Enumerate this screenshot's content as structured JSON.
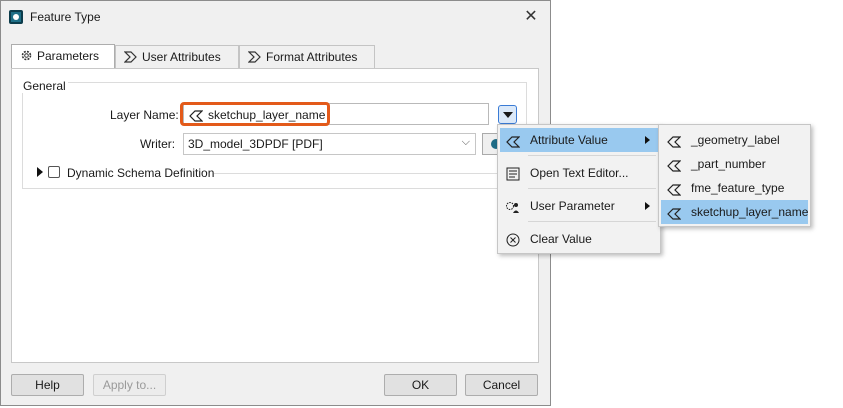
{
  "window": {
    "title": "Feature Type"
  },
  "tabs": [
    {
      "label": "Parameters",
      "icon": "gear-icon"
    },
    {
      "label": "User Attributes",
      "icon": "attribute-icon"
    },
    {
      "label": "Format Attributes",
      "icon": "attribute-icon"
    }
  ],
  "general": {
    "group_title": "General",
    "layer_name_label": "Layer Name:",
    "layer_name_value": "sketchup_layer_name",
    "writer_label": "Writer:",
    "writer_value": "3D_model_3DPDF [PDF]",
    "schema_label": "Dynamic Schema Definition",
    "schema_checked": false
  },
  "buttons": {
    "help": "Help",
    "apply": "Apply to...",
    "ok": "OK",
    "cancel": "Cancel"
  },
  "context_menu": {
    "items": [
      {
        "label": "Attribute Value",
        "icon": "attribute-icon",
        "submenu": true,
        "highlighted": true
      },
      {
        "label": "Open Text Editor...",
        "icon": "text-editor-icon",
        "submenu": false
      },
      {
        "label": "User Parameter",
        "icon": "user-parameter-icon",
        "submenu": true
      },
      {
        "label": "Clear Value",
        "icon": "clear-icon",
        "submenu": false
      }
    ]
  },
  "attribute_submenu": {
    "items": [
      {
        "label": "_geometry_label"
      },
      {
        "label": "_part_number"
      },
      {
        "label": "fme_feature_type"
      },
      {
        "label": "sketchup_layer_name",
        "highlighted": true
      }
    ]
  },
  "colors": {
    "highlight_outline": "#e35a1a",
    "menu_highlight": "#99c9ef",
    "dialog_bg": "#f0f0f0"
  }
}
